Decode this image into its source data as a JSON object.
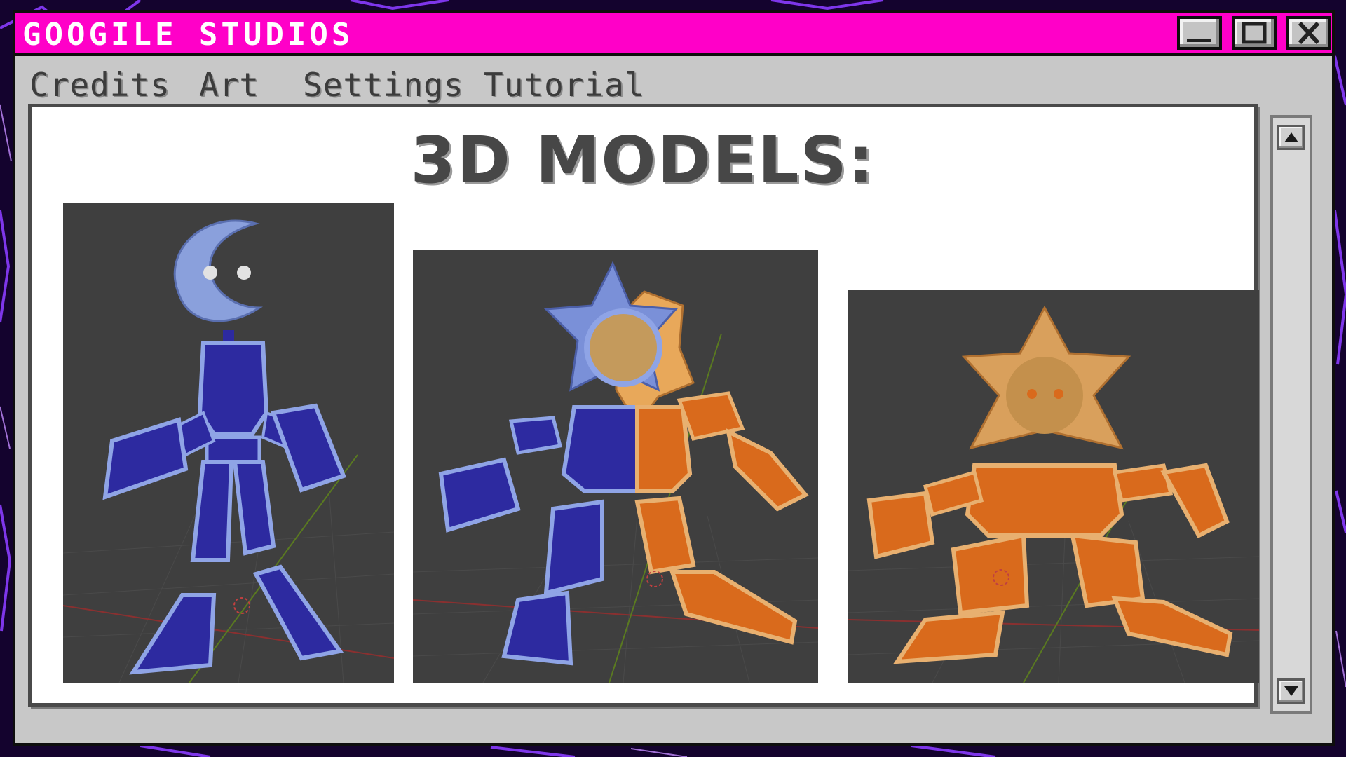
{
  "window": {
    "title": "GOOGILE STUDIOS",
    "controls": [
      "minimize-icon",
      "maximize-icon",
      "close-icon"
    ]
  },
  "menu": {
    "items": [
      {
        "label": "Credits"
      },
      {
        "label": "Art"
      },
      {
        "label": "Settings"
      },
      {
        "label": "Tutorial"
      }
    ]
  },
  "content": {
    "title": "3D MODELS:",
    "images": [
      {
        "subject": "moon-character-model"
      },
      {
        "subject": "moon-sun-hybrid-character-model"
      },
      {
        "subject": "sun-character-model"
      }
    ]
  },
  "scrollbar": {
    "up_icon": "arrow-up-icon",
    "down_icon": "arrow-down-icon"
  },
  "colors": {
    "titlebar": "#ff00c8",
    "window": "#c8c8c8",
    "viewport": "#3f3f3f",
    "moon_body": "#2d2aa0",
    "moon_trim": "#8fa4e6",
    "sun_body": "#d96a1c",
    "sun_trim": "#e8b070"
  }
}
